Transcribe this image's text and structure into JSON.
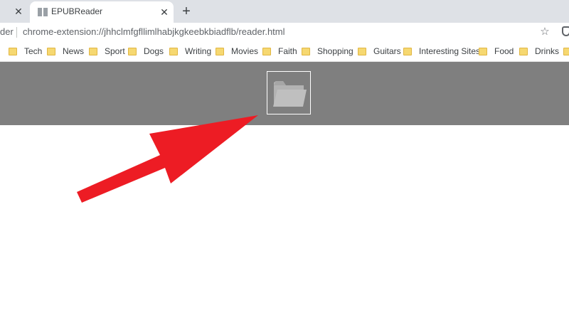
{
  "browser": {
    "prev_tab": {
      "close_icon": "close-icon"
    },
    "active_tab": {
      "title": "EPUBReader",
      "favicon": "book-icon",
      "close_icon": "close-icon"
    },
    "new_tab_icon": "plus-icon",
    "address": {
      "host_fragment": "der",
      "url": "chrome-extension://jhhclmfgfllimlhabjkgkeebkbiadflb/reader.html"
    },
    "bookmark_star_icon": "star-icon",
    "extension_icon": "shield-icon"
  },
  "bookmarks": [
    {
      "label": "Tech"
    },
    {
      "label": "News"
    },
    {
      "label": "Sport"
    },
    {
      "label": "Dogs"
    },
    {
      "label": "Writing"
    },
    {
      "label": "Movies"
    },
    {
      "label": "Faith"
    },
    {
      "label": "Shopping"
    },
    {
      "label": "Guitars"
    },
    {
      "label": "Interesting Sites"
    },
    {
      "label": "Food"
    },
    {
      "label": "Drinks"
    }
  ],
  "reader": {
    "open_button_icon": "folder-open-icon",
    "header_color": "#7f7f7f"
  },
  "annotation": {
    "arrow_color": "#ed1c24",
    "arrow_icon": "red-arrow"
  }
}
